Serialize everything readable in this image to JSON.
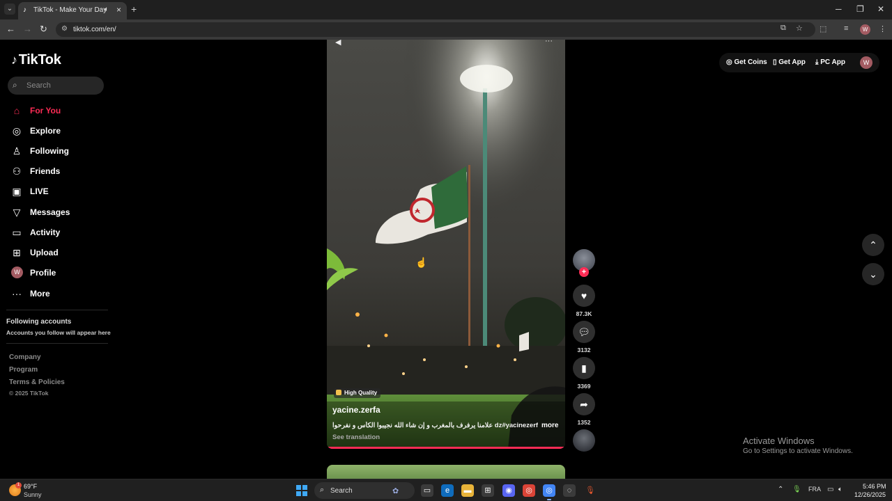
{
  "browser": {
    "tab_title": "TikTok - Make Your Day",
    "url": "tiktok.com/en/",
    "profile_initial": "W"
  },
  "tiktok": {
    "logo": "TikTok",
    "search_placeholder": "Search",
    "nav": [
      {
        "label": "For You",
        "icon": "home-icon",
        "active": true
      },
      {
        "label": "Explore",
        "icon": "compass-icon"
      },
      {
        "label": "Following",
        "icon": "following-icon"
      },
      {
        "label": "Friends",
        "icon": "friends-icon"
      },
      {
        "label": "LIVE",
        "icon": "live-icon"
      },
      {
        "label": "Messages",
        "icon": "messages-icon"
      },
      {
        "label": "Activity",
        "icon": "activity-icon"
      },
      {
        "label": "Upload",
        "icon": "upload-icon"
      },
      {
        "label": "Profile",
        "icon": "avatar",
        "avatar_initial": "W"
      },
      {
        "label": "More",
        "icon": "more-icon"
      }
    ],
    "following_heading": "Following accounts",
    "following_sub": "Accounts you follow will appear here",
    "footer_links": [
      "Company",
      "Program",
      "Terms & Policies"
    ],
    "copyright": "© 2025 TikTok",
    "actions": {
      "get_coins": "Get Coins",
      "get_app": "Get App",
      "pc_app": "PC App",
      "user_initial": "W"
    }
  },
  "video": {
    "quality_badge": "High Quality",
    "author": "yacine.zerfa",
    "caption": "علامنا يرفرف بالمغرب و إن شاء الله نجيبوا الكأس و نفرحوا dz#yacinezerfa...",
    "more_label": "more",
    "see_translation": "See translation",
    "progress": 1.0,
    "likes": "87.3K",
    "comments": "3132",
    "saves": "3369",
    "shares": "1352"
  },
  "watermark": {
    "line1": "Activate Windows",
    "line2": "Go to Settings to activate Windows."
  },
  "taskbar": {
    "temperature": "69°F",
    "condition": "Sunny",
    "weather_badge": "1",
    "search_label": "Search",
    "language": "FRA",
    "time": "5:46 PM",
    "date": "12/26/2025"
  }
}
